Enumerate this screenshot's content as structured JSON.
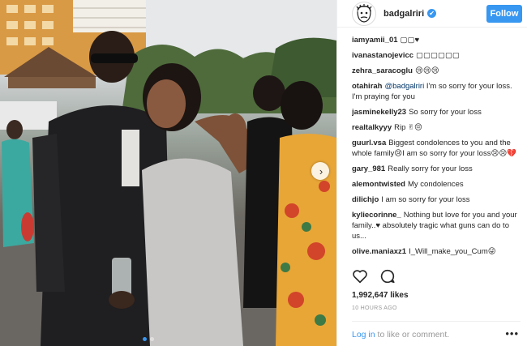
{
  "header": {
    "username": "badgalriri",
    "verified_glyph": "✔",
    "follow_label": "Follow"
  },
  "photo": {
    "next_arrow_glyph": "›"
  },
  "comments": [
    {
      "user": "iamyamii_01",
      "text": "▢▢♥"
    },
    {
      "user": "ivanastanojevicc",
      "text": "▢▢▢▢▢▢"
    },
    {
      "user": "zehra_saracoglu",
      "text": "😢😢😢"
    },
    {
      "user": "otahirah",
      "mention": "@badgalriri",
      "text": "I'm so sorry for your loss. I'm praying for you"
    },
    {
      "user": "jasminekelly23",
      "text": "So sorry for your loss"
    },
    {
      "user": "realtalkyyy",
      "text": "Rip ✌😔"
    },
    {
      "user": "guurl.vsa",
      "text": "Biggest condolences to you and the whole family😢I am so sorry for your loss😢😢💔"
    },
    {
      "user": "gary_981",
      "text": "Really sorry for your loss"
    },
    {
      "user": "alemontwisted",
      "text": "My condolences"
    },
    {
      "user": "dilichjo",
      "text": "I am so sorry for your loss"
    },
    {
      "user": "kyliecorinne_",
      "text": "Nothing but love for you and your family..♥ absolutely tragic what guns can do to us..."
    },
    {
      "user": "olive.maniaxz1",
      "text": "I_Will_make_you_Cum😜"
    }
  ],
  "stats": {
    "likes": "1,992,647 likes",
    "time_ago": "10 HOURS AGO"
  },
  "footer": {
    "login_link": "Log in",
    "login_rest": " to like or comment.",
    "more_glyph": "•••"
  },
  "icons": {
    "like": "heart-icon",
    "comment": "comment-bubble-icon",
    "more": "more-options-icon",
    "next": "chevron-right-icon"
  },
  "colors": {
    "accent": "#3897f0",
    "text": "#262626",
    "muted": "#999999"
  }
}
